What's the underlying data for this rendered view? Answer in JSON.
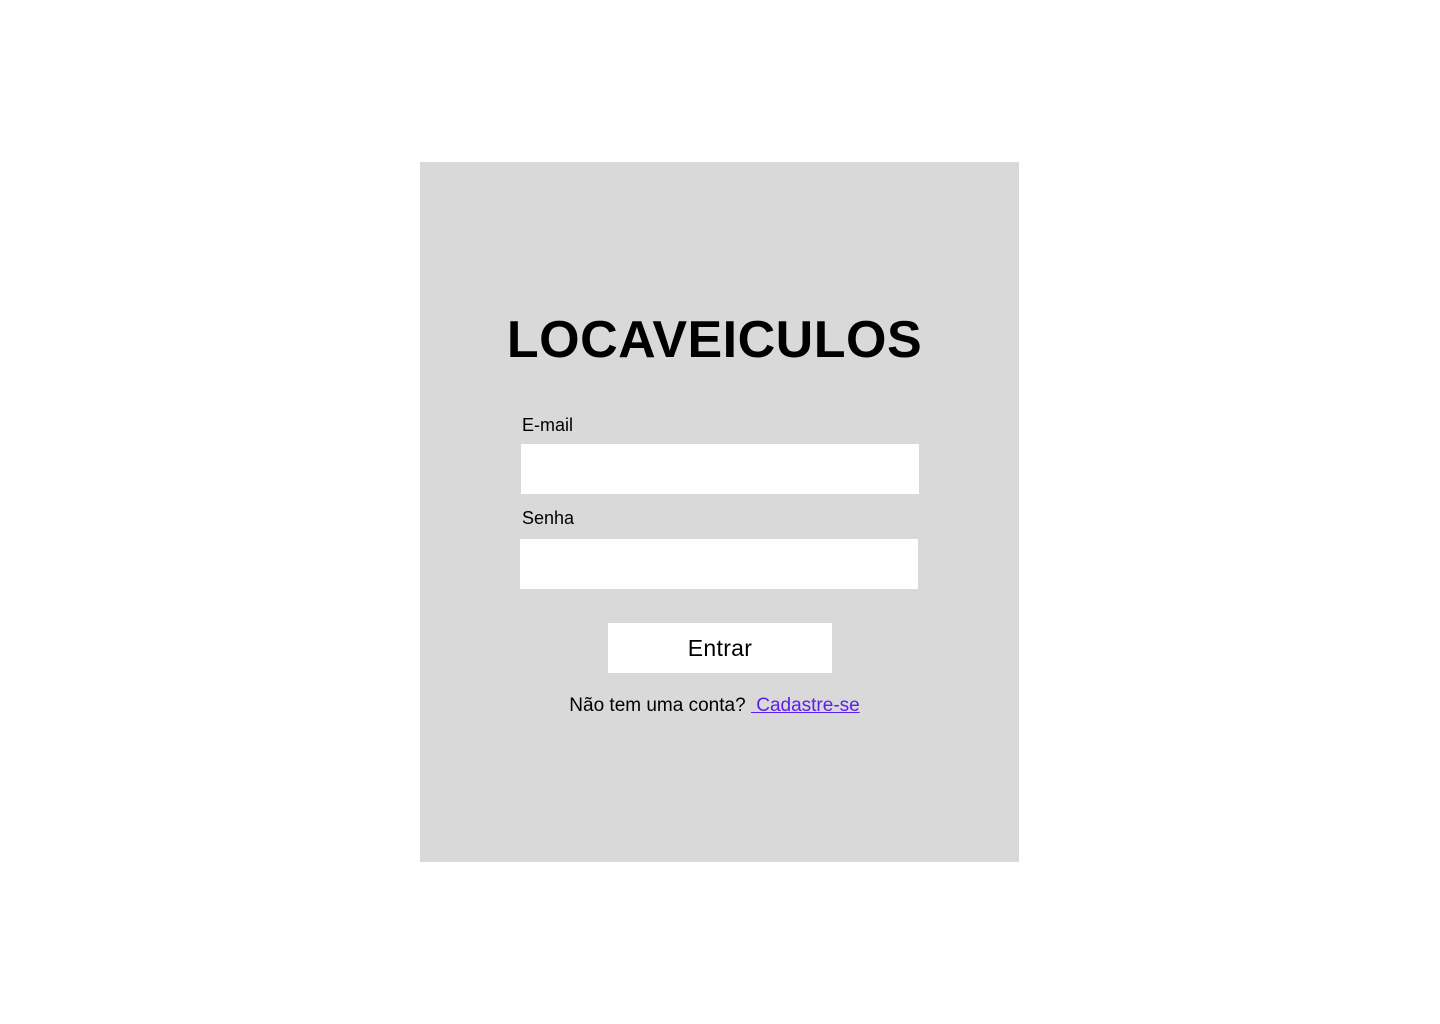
{
  "brand": {
    "title": "LOCAVEICULOS"
  },
  "form": {
    "email": {
      "label": "E-mail",
      "value": "",
      "placeholder": ""
    },
    "password": {
      "label": "Senha",
      "value": "",
      "placeholder": ""
    },
    "submit_label": "Entrar"
  },
  "signup": {
    "prompt": "Não tem uma conta?",
    "link_label": "Cadastre-se"
  },
  "colors": {
    "page_background": "#ffffff",
    "card_background": "#d9d9d9",
    "input_background": "#ffffff",
    "link": "#5b1ff0",
    "text": "#000000"
  }
}
